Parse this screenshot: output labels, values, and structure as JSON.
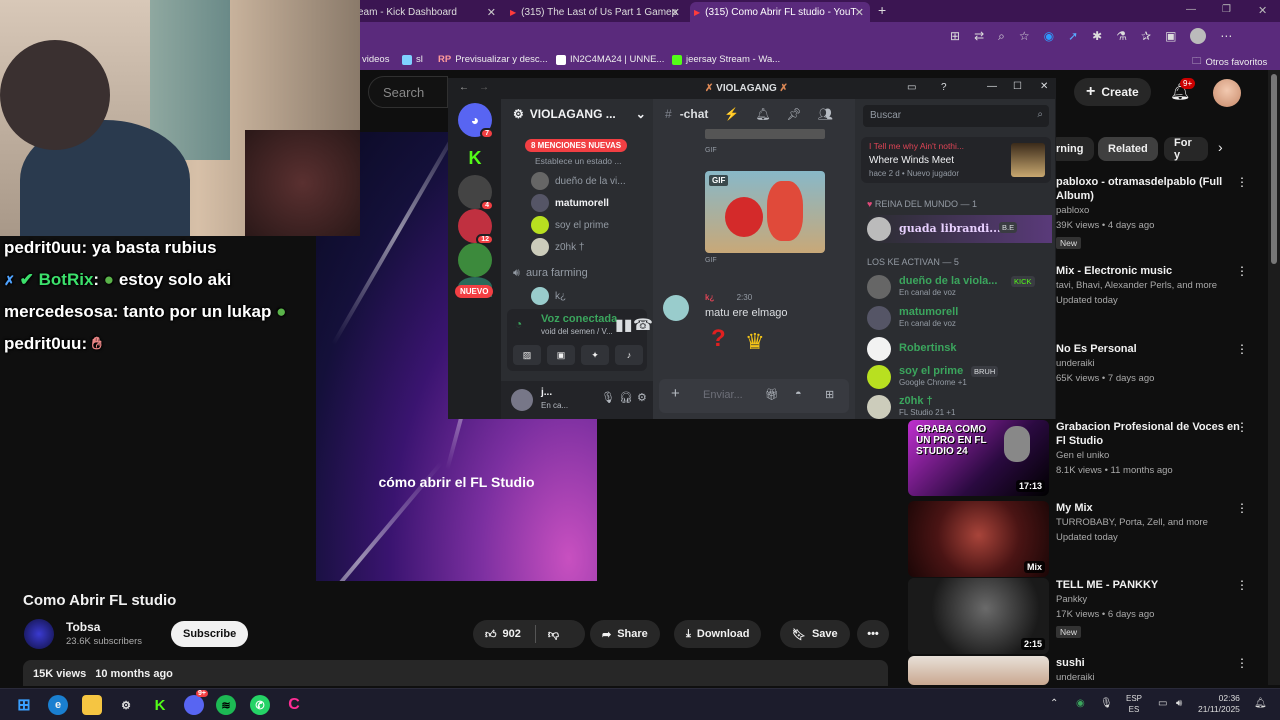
{
  "browser": {
    "tabs": [
      {
        "label": "eam - Kick Dashboard",
        "active": false
      },
      {
        "label": "(315) The Last of Us Part 1 Gamep",
        "active": false
      },
      {
        "label": "(315) Como Abrir FL studio - YouT",
        "active": true
      }
    ],
    "new_tab": "+",
    "bookmarks": [
      {
        "label": "videos"
      },
      {
        "label": "sl"
      },
      {
        "label": "Previsualizar y desc..."
      },
      {
        "label": "IN2C4MA24 | UNNE..."
      },
      {
        "label": "jeersay Stream - Wa..."
      }
    ],
    "other_bookmarks": "Otros favoritos"
  },
  "youtube": {
    "search_placeholder": "Search",
    "create_label": "Create",
    "notif_count": "9+",
    "video": {
      "caption": "cómo abrir el FL Studio",
      "title": "Como Abrir FL studio",
      "channel": "Tobsa",
      "subscribers": "23.6K subscribers",
      "subscribe_label": "Subscribe",
      "likes": "902",
      "share_label": "Share",
      "download_label": "Download",
      "save_label": "Save",
      "more_label": "•••",
      "views": "15K views",
      "age": "10 months ago"
    },
    "chips": [
      {
        "label": "rning"
      },
      {
        "label": "Related"
      },
      {
        "label": "For y"
      }
    ],
    "recommendations": [
      {
        "title": "pabloxo - otramasdelpablo (Full Album)",
        "line1": "pabloxo",
        "line2": "39K views • 4 days ago",
        "badge": "New",
        "duration": ""
      },
      {
        "title": "Mix - Electronic music",
        "line1": "tavi, Bhavi, Alexander Perls, and more",
        "line2": "Updated today",
        "badge": "",
        "duration": ""
      },
      {
        "title": "No Es Personal",
        "line1": "underaiki",
        "line2": "65K views • 7 days ago",
        "badge": "",
        "duration": ""
      },
      {
        "title": "Grabacion Profesional de Voces en Fl Studio",
        "line1": "Gen el uniko",
        "line2": "8.1K views • 11 months ago",
        "badge": "",
        "duration": "17:13",
        "thumb_text": "GRABA COMO UN PRO EN FL STUDIO 24"
      },
      {
        "title": "My Mix",
        "line1": "TURROBABY, Porta, Zell, and more",
        "line2": "Updated today",
        "badge": "",
        "duration": "Mix"
      },
      {
        "title": "TELL ME - PANKKY",
        "line1": "Pankky",
        "line2": "17K views • 6 days ago",
        "badge": "New",
        "duration": "2:15"
      },
      {
        "title": "sushi",
        "line1": "underaiki",
        "line2": "",
        "badge": "",
        "duration": ""
      }
    ]
  },
  "stream_chat": [
    {
      "user": "pedrit0uu",
      "message": "ya basta rubius"
    },
    {
      "user": "BotRix",
      "message": "estoy solo aki"
    },
    {
      "user": "mercedesosa",
      "message": "tanto por un lukap"
    },
    {
      "user": "pedrit0uu",
      "message": ""
    }
  ],
  "discord": {
    "window_title": "VIOLAGANG",
    "server_name": "VIOLAGANG ...",
    "new_mentions": "8 MENCIONES NUEVAS",
    "status_hint": "Establece un estado ...",
    "channel_name": "-chat",
    "search_placeholder": "Buscar",
    "guild_badges": [
      "7",
      "4",
      "12"
    ],
    "guild_new": "NUEVO",
    "voice_members": [
      {
        "name": "dueño de la vi..."
      },
      {
        "name": "matumorell"
      },
      {
        "name": "soy el prime"
      },
      {
        "name": "z0hk †"
      }
    ],
    "voice_channel_2": "aura farming",
    "voice_member_2": "k¿",
    "voice_status": "Voz conectada",
    "voice_sub": "void del semen / V...",
    "user_name": "j...",
    "user_status": "En ca...",
    "messages": [
      {
        "label": "GIF"
      },
      {
        "label": "GIF"
      }
    ],
    "last_message": {
      "author": "k¿",
      "time": "2:30",
      "text": "matu ere elmago"
    },
    "composer_placeholder": "Enviar...",
    "activity": {
      "top": "I Tell me why Ain't nothi...",
      "title": "Where Winds Meet",
      "sub": "hace 2 d",
      "sub2": "Nuevo jugador"
    },
    "role1": "REINA DEL MUNDO — 1",
    "role1_member": {
      "name": "guada librandi...",
      "tag": "B.E"
    },
    "role2": "LOS KE ACTIVAN — 5",
    "members": [
      {
        "name": "dueño de la viola...",
        "status": "En canal de voz",
        "tag": "KICK"
      },
      {
        "name": "matumorell",
        "status": "En canal de voz",
        "tag": ""
      },
      {
        "name": "Robertinsk",
        "status": "",
        "tag": ""
      },
      {
        "name": "soy el prime",
        "status": "Google Chrome +1",
        "tag": "BRUH"
      },
      {
        "name": "z0hk †",
        "status": "FL Studio 21 +1",
        "tag": ""
      }
    ]
  },
  "taskbar": {
    "lang": "ESP",
    "lang2": "ES",
    "time": "02:36",
    "date": "21/11/2025",
    "discord_badge": "9+"
  }
}
